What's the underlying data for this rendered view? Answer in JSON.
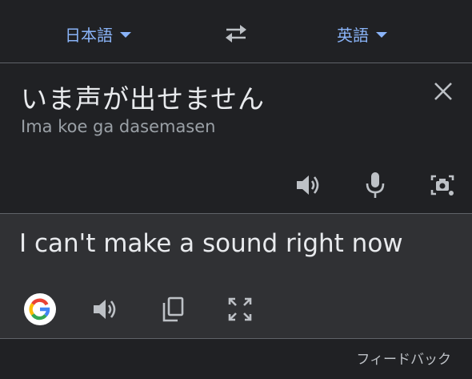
{
  "language_bar": {
    "source_language": "日本語",
    "target_language": "英語"
  },
  "source": {
    "text": "いま声が出せません",
    "transliteration": "Ima koe ga dasemasen"
  },
  "result": {
    "text": "I can't make a sound right now"
  },
  "footer": {
    "feedback_label": "フィードバック"
  },
  "icons": {
    "source_language_caret": "chevron-down-icon",
    "swap": "swap-arrows-icon",
    "clear": "close-icon",
    "source_listen": "speaker-icon",
    "microphone": "microphone-icon",
    "camera": "camera-translate-icon",
    "google": "google-logo-icon",
    "result_listen": "speaker-icon",
    "copy": "copy-icon",
    "fullscreen": "fullscreen-icon"
  },
  "colors": {
    "background": "#202124",
    "result_background": "#303134",
    "accent": "#8ab4f8",
    "text_primary": "#e8eaed",
    "text_secondary": "#9aa0a6",
    "icon": "#bdc1c6"
  }
}
